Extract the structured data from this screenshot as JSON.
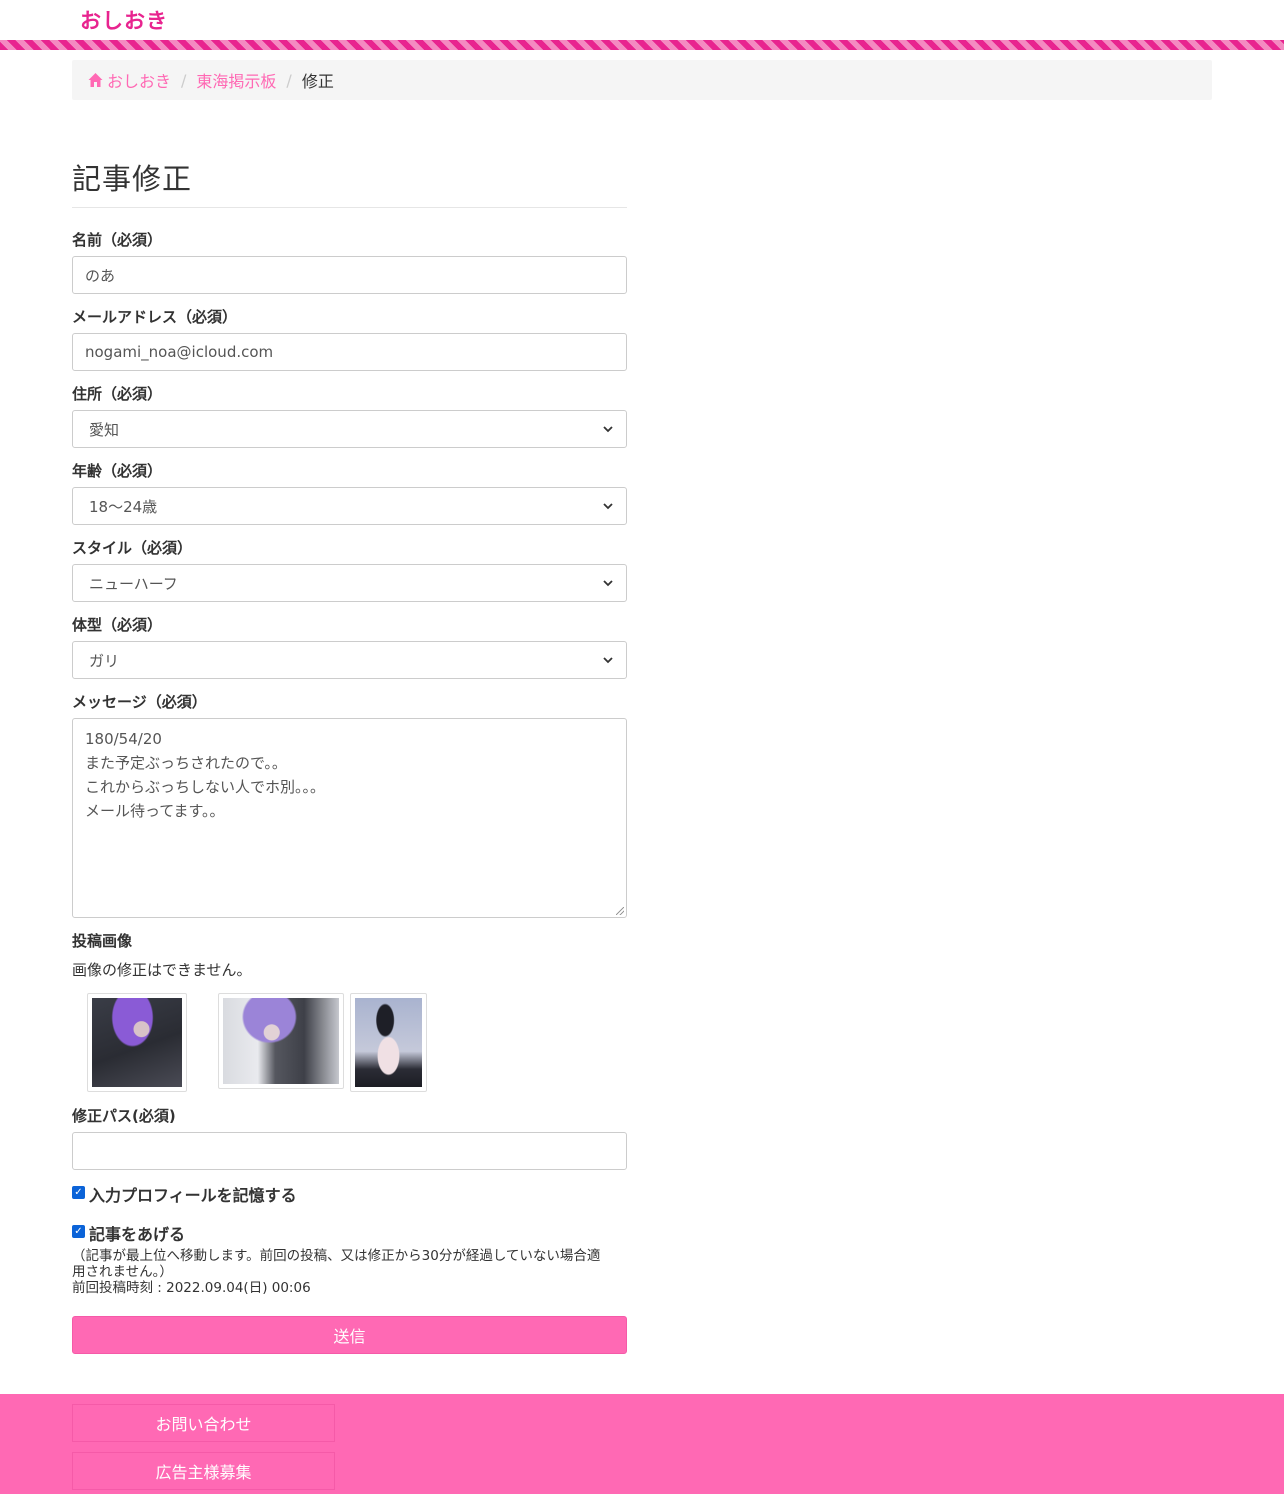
{
  "header": {
    "logo": "おしおき"
  },
  "breadcrumb": {
    "home": "おしおき",
    "board": "東海掲示板",
    "current": "修正"
  },
  "form": {
    "title": "記事修正",
    "name_label": "名前（必須）",
    "name_value": "のあ",
    "email_label": "メールアドレス（必須）",
    "email_value": "nogami_noa@icloud.com",
    "address_label": "住所（必須）",
    "address_value": "愛知",
    "age_label": "年齢（必須）",
    "age_value": "18〜24歳",
    "style_label": "スタイル（必須）",
    "style_value": "ニューハーフ",
    "body_label": "体型（必須）",
    "body_value": "ガリ",
    "message_label": "メッセージ（必須）",
    "message_lines": [
      "180/54/20",
      "また予定ぶっちされたので。。",
      "これからぶっちしない人でホ別。。。",
      "メール待ってます。。"
    ],
    "images_label": "投稿画像",
    "images_note": "画像の修正はできません。",
    "password_label": "修正パス(必須)",
    "remember_label": "入力プロフィールを記憶する",
    "bump_label": "記事をあげる",
    "bump_note_1": "（記事が最上位へ移動します。前回の投稿、又は修正から30分が経過していない場合適",
    "bump_note_2": "用されません。）",
    "last_post": "前回投稿時刻 : 2022.09.04(日) 00:06",
    "submit": "送信"
  },
  "footer": {
    "contact": "お問い合わせ",
    "ads": "広告主様募集"
  },
  "colors": {
    "accent": "#ff69b4",
    "logo": "#e8248f"
  }
}
